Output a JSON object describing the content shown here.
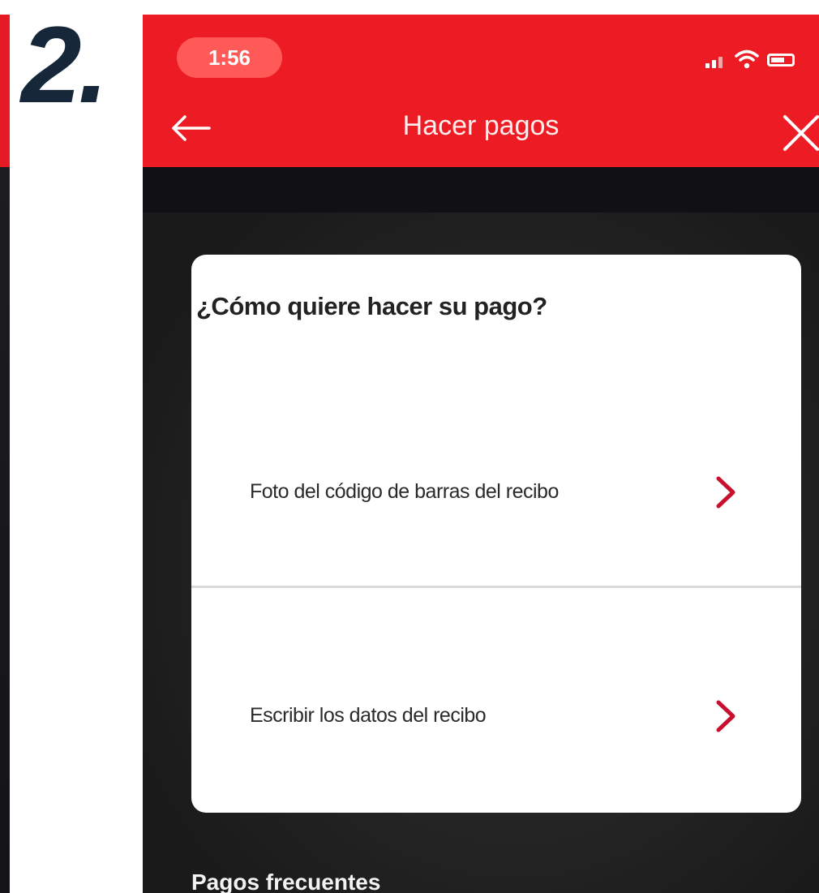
{
  "step_label": "2.",
  "status_bar": {
    "time": "1:56"
  },
  "header": {
    "title": "Hacer pagos"
  },
  "payment_card": {
    "question": "¿Cómo quiere hacer su pago?",
    "options": [
      {
        "label": "Foto del código de barras del recibo"
      },
      {
        "label": "Escribir los datos del recibo"
      }
    ]
  },
  "frequent_payments": {
    "title": "Pagos frecuentes"
  },
  "colors": {
    "brand_red": "#ed1c24",
    "chevron_red": "#c8102e",
    "step_number": "#16273a"
  }
}
